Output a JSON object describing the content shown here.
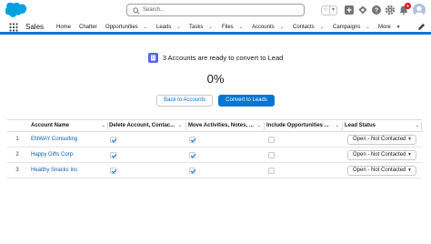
{
  "header": {
    "search_placeholder": "Search...",
    "notification_count": "6"
  },
  "nav": {
    "app_name": "Sales",
    "items": [
      {
        "label": "Home",
        "has_menu": false
      },
      {
        "label": "Chatter",
        "has_menu": false
      },
      {
        "label": "Opportunities",
        "has_menu": true
      },
      {
        "label": "Leads",
        "has_menu": true
      },
      {
        "label": "Tasks",
        "has_menu": true
      },
      {
        "label": "Files",
        "has_menu": true
      },
      {
        "label": "Accounts",
        "has_menu": true
      },
      {
        "label": "Contacts",
        "has_menu": true
      },
      {
        "label": "Campaigns",
        "has_menu": true
      },
      {
        "label": "More",
        "has_menu": true
      }
    ],
    "accent_color": "#0176d3"
  },
  "main": {
    "heading": "3 Accounts are ready to convert to Lead",
    "progress": "0%",
    "back_button": "Back to Accounts",
    "convert_button": "Convert to Leads",
    "columns": [
      "Account Name",
      "Delete Account, Contac...",
      "Move Activities, Notes, ...",
      "Include Opportunities ...",
      "Lead Status"
    ],
    "rows": [
      {
        "num": "1",
        "name": "ENWAY Consulting",
        "delete": true,
        "move": true,
        "include": false,
        "status": "Open - Not Contacted"
      },
      {
        "num": "2",
        "name": "Happy Gifts Corp",
        "delete": true,
        "move": true,
        "include": false,
        "status": "Open - Not Contacted"
      },
      {
        "num": "3",
        "name": "Healthy Snacks Inc",
        "delete": true,
        "move": true,
        "include": false,
        "status": "Open - Not Contacted"
      }
    ]
  }
}
